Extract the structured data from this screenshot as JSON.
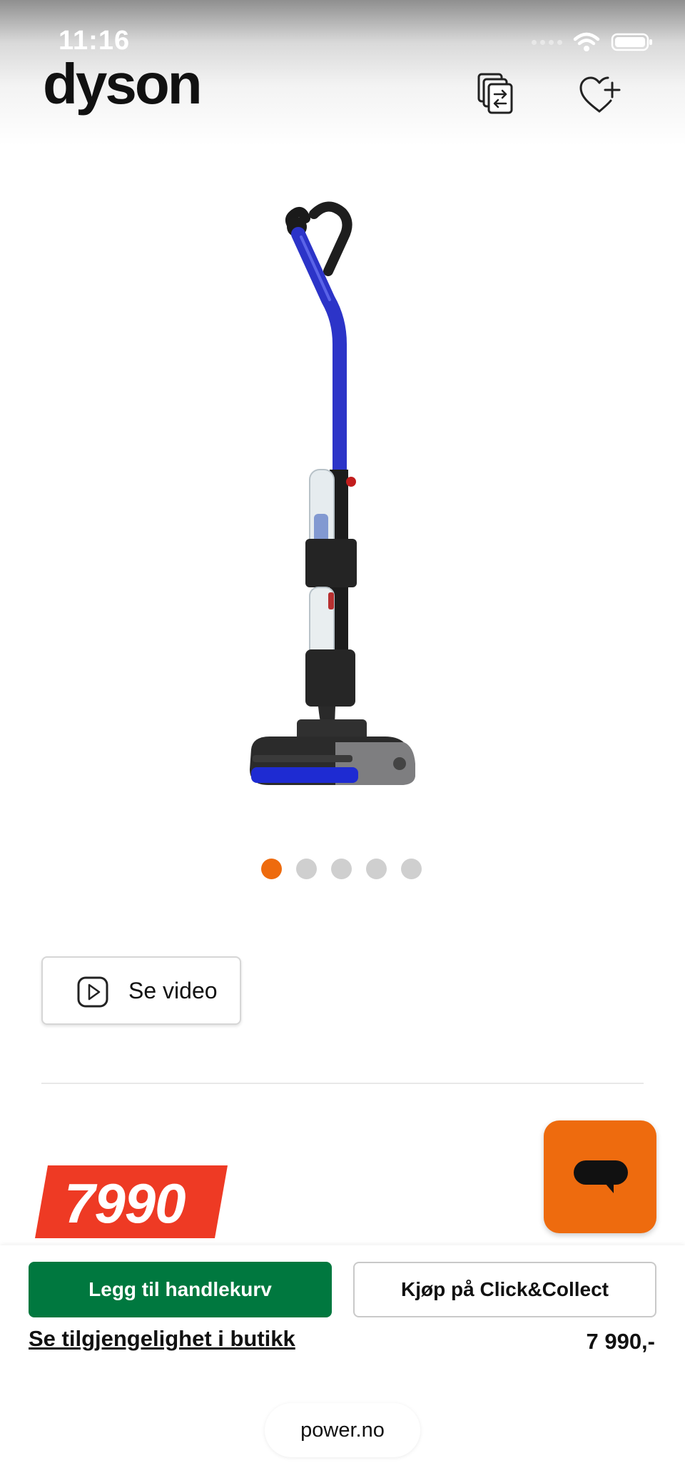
{
  "status_bar": {
    "time": "11:16"
  },
  "header": {
    "brand": "dyson",
    "compare_icon": "compare-icon",
    "wishlist_icon": "heart-plus-icon"
  },
  "product": {
    "image": "Dyson wet floor cleaner",
    "carousel": {
      "total": 5,
      "active": 1
    },
    "video_label": "Se video",
    "price_badge": "7990",
    "price": "7 990,-"
  },
  "actions": {
    "add_to_cart": "Legg til handlekurv",
    "click_collect": "Kjøp på Click&Collect",
    "availability_link": "Se tilgjengelighet i butikk"
  },
  "browser": {
    "url": "power.no"
  },
  "colors": {
    "accent_orange": "#ee6b0e",
    "cart_green": "#00783f",
    "price_red": "#ee3a24"
  }
}
